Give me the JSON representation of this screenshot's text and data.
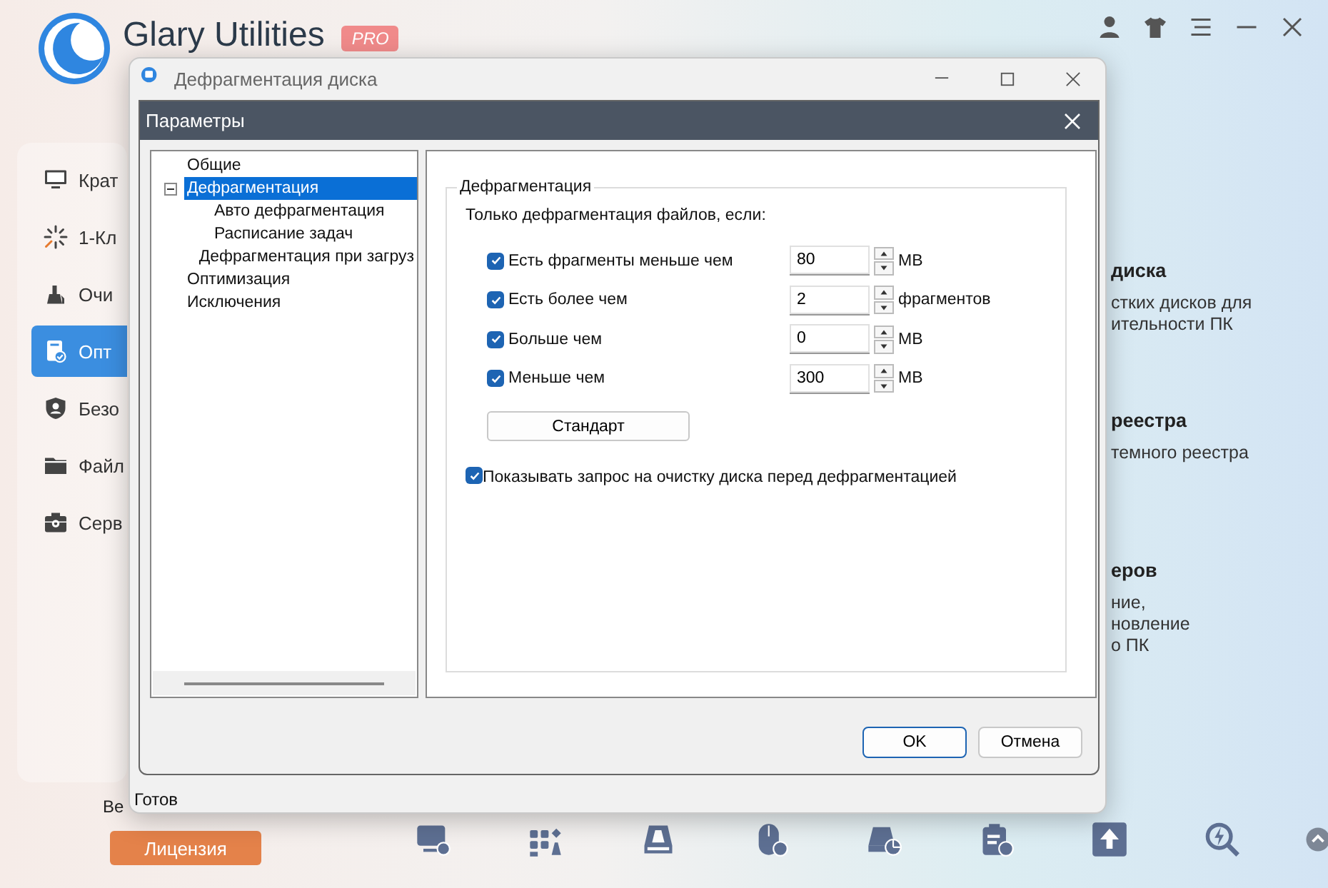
{
  "app": {
    "title": "Glary Utilities",
    "badge": "PRO",
    "sidebar": [
      {
        "label": "Крат",
        "selected": false
      },
      {
        "label": "1-Кл",
        "selected": false
      },
      {
        "label": "Очи",
        "selected": false
      },
      {
        "label": "Опт",
        "selected": true
      },
      {
        "label": "Безо",
        "selected": false
      },
      {
        "label": "Файл",
        "selected": false
      },
      {
        "label": "Серв",
        "selected": false
      }
    ],
    "panels": [
      {
        "title": "диска",
        "lines": [
          "стких дисков для",
          "ительности ПК"
        ]
      },
      {
        "title": "реестра",
        "lines": [
          "темного реестра"
        ]
      },
      {
        "title": "еров",
        "lines": [
          "ние,",
          "новление",
          "о ПК"
        ]
      }
    ],
    "footer_text": "Ве",
    "license_button": "Лицензия"
  },
  "defrag_window": {
    "title": "Дефрагментация диска",
    "status": "Готов"
  },
  "dialog": {
    "title": "Параметры",
    "tree": [
      {
        "label": "Общие",
        "selected": false
      },
      {
        "label": "Дефрагментация",
        "selected": true,
        "expanded": true,
        "children": [
          {
            "label": "Авто дефрагментация",
            "selected": false
          },
          {
            "label": "Расписание задач",
            "selected": false
          },
          {
            "label": "Дефрагментация при загруз",
            "selected": false
          }
        ]
      },
      {
        "label": "Оптимизация",
        "selected": false
      },
      {
        "label": "Исключения",
        "selected": false
      }
    ],
    "group_title": "Дефрагментация",
    "intro": "Только дефрагментация файлов, если:",
    "conditions": [
      {
        "label": "Есть фрагменты меньше чем",
        "checked": true,
        "value": "80",
        "unit": "MB"
      },
      {
        "label": "Есть более чем",
        "checked": true,
        "value": "2",
        "unit": "фрагментов"
      },
      {
        "label": "Больше чем",
        "checked": true,
        "value": "0",
        "unit": "MB"
      },
      {
        "label": "Меньше чем",
        "checked": true,
        "value": "300",
        "unit": "MB"
      }
    ],
    "default_button": "Стандарт",
    "cleanup_prompt": {
      "label": "Показывать запрос на очистку диска перед дефрагментацией",
      "checked": true
    },
    "buttons": [
      "OK",
      "Отмена"
    ]
  }
}
